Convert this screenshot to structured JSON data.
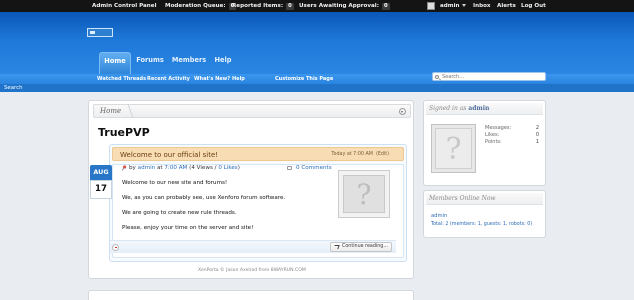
{
  "adminbar": {
    "control_panel": "Admin Control Panel",
    "moderation_label": "Moderation Queue:",
    "moderation_count": "0",
    "reported_label": "Reported Items:",
    "reported_count": "0",
    "approval_label": "Users Awaiting Approval:",
    "approval_count": "0",
    "user": "admin",
    "inbox": "Inbox",
    "alerts": "Alerts",
    "logout": "Log Out"
  },
  "nav": {
    "tabs": [
      "Home",
      "Forums",
      "Members",
      "Help"
    ],
    "selected": "Home",
    "sub": [
      "Watched Threads",
      "Recent Activity",
      "What's New?",
      "Help",
      "Customize This Page"
    ]
  },
  "search": {
    "placeholder": "Search...",
    "label": "Search"
  },
  "breadcrumb": {
    "home": "Home"
  },
  "page": {
    "title": "TruePVP"
  },
  "article": {
    "title": "Welcome to our official site!",
    "date_line": "Today at 7:00 AM",
    "edit": "(Edit)",
    "badge_month": "AUG",
    "badge_day": "17",
    "by": "by",
    "author": "admin",
    "at": "at",
    "time": "7:00 AM",
    "views_pre": "(4 Views / ",
    "likes": "0 Likes",
    "views_post": ")",
    "comments": "0 Comments",
    "paragraphs": [
      "Welcome to our new site and forums!",
      "We, as you can probably see, use Xenforo forum software.",
      "We are going to create new rule threads.",
      "Please, enjoy your time on the server and site!"
    ],
    "continue": "Continue reading..."
  },
  "footer": {
    "credit": "XenPorta © Jason Axelrod from 8WAYRUN.COM"
  },
  "sidebar": {
    "signed_in_label": "Signed in as",
    "signed_in_user": "admin",
    "stats": [
      {
        "label": "Messages:",
        "value": "2"
      },
      {
        "label": "Likes:",
        "value": "0"
      },
      {
        "label": "Points:",
        "value": "1"
      }
    ],
    "online_title": "Members Online Now",
    "online_member": "admin",
    "online_total": "Total: 2 (members: 1, guests: 1, robots: 0)"
  },
  "colors": {
    "header_blue": "#1e78d8",
    "article_header": "#f8dcb3",
    "link": "#2b6cb8",
    "badge_blue": "#2876c8"
  }
}
